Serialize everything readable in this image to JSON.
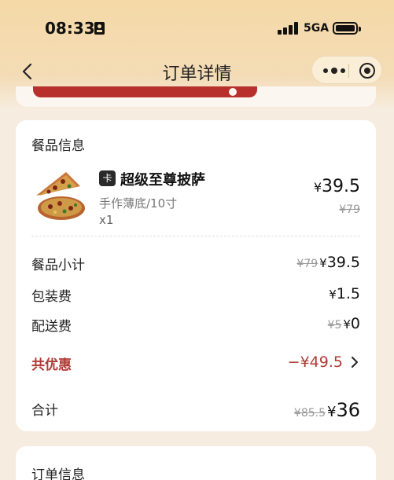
{
  "status_bar": {
    "time": "08:33",
    "network": "5GA"
  },
  "nav": {
    "title": "订单详情"
  },
  "food_section": {
    "title": "餐品信息",
    "item": {
      "badge": "卡",
      "name": "超级至尊披萨",
      "spec": "手作薄底/10寸",
      "qty": "x1",
      "price": "39.5",
      "currency": "¥",
      "original_price": "¥79"
    }
  },
  "fees": {
    "subtotal": {
      "label": "餐品小计",
      "original": "¥79",
      "value": "39.5"
    },
    "packaging": {
      "label": "包装费",
      "value": "1.5"
    },
    "delivery": {
      "label": "配送费",
      "original": "¥5",
      "value": "0"
    },
    "discount": {
      "label": "共优惠",
      "value": "−¥49.5"
    },
    "total": {
      "label": "合计",
      "original": "¥85.5",
      "value": "36"
    }
  },
  "next_section": {
    "title": "订单信息"
  },
  "colors": {
    "accent_red": "#b03a35",
    "header_bg": "#f5d9a6",
    "page_bg": "#f6ede0"
  }
}
